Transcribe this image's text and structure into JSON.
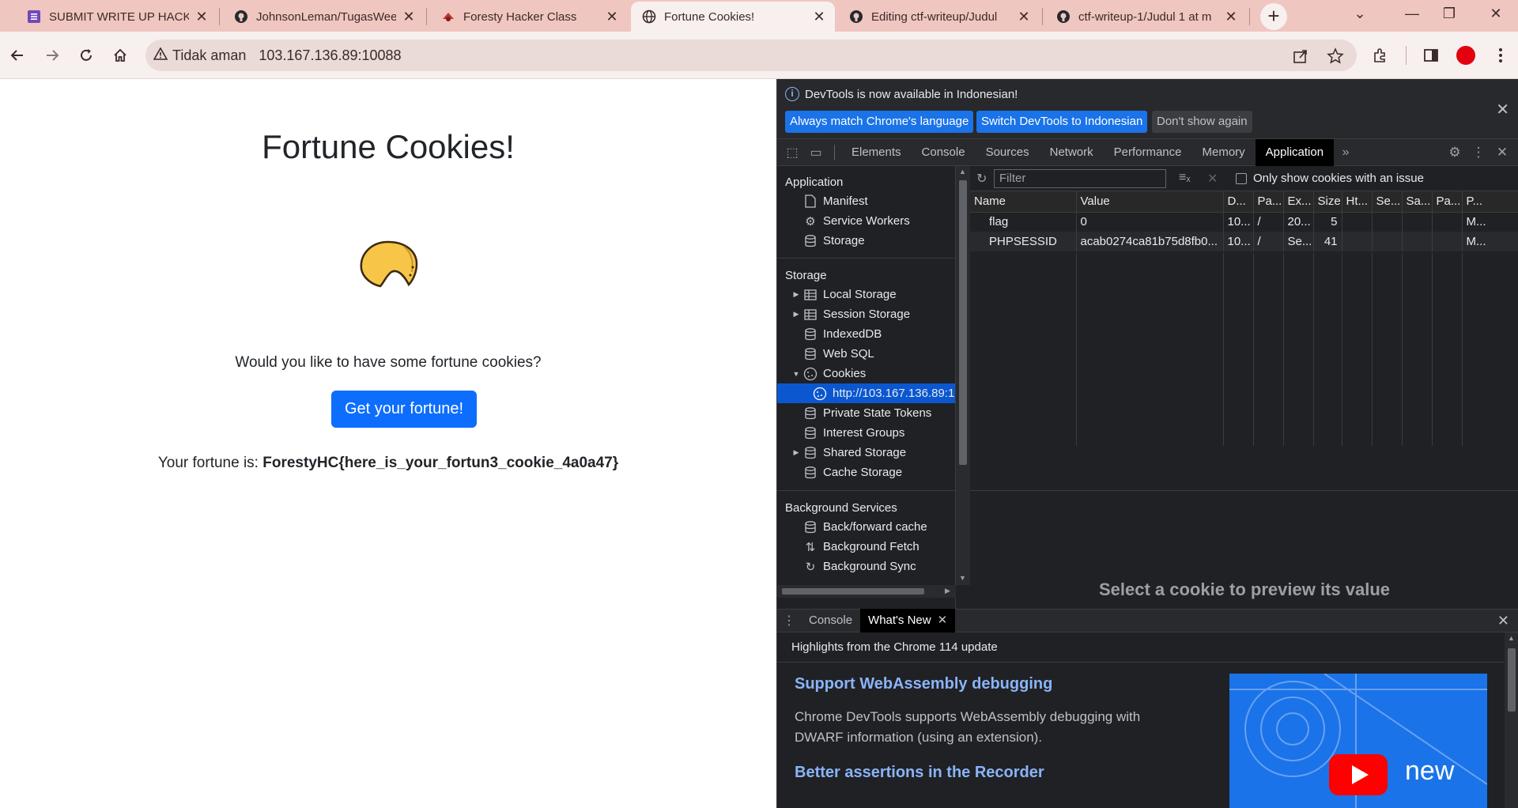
{
  "browser": {
    "tabs": [
      {
        "title": "SUBMIT WRITE UP HACKER",
        "icon": "forms-icon",
        "active": false
      },
      {
        "title": "JohnsonLeman/TugasWeek",
        "icon": "github-icon",
        "active": false
      },
      {
        "title": "Foresty Hacker Class",
        "icon": "ctfd-icon",
        "active": false
      },
      {
        "title": "Fortune Cookies!",
        "icon": "globe-icon",
        "active": true
      },
      {
        "title": "Editing ctf-writeup/Judul",
        "icon": "github-icon",
        "active": false
      },
      {
        "title": "ctf-writeup-1/Judul 1 at m",
        "icon": "github-icon",
        "active": false
      }
    ],
    "security_label": "Tidak aman",
    "url": "103.167.136.89:10088"
  },
  "page": {
    "title": "Fortune Cookies!",
    "question": "Would you like to have some fortune cookies?",
    "button_label": "Get your fortune!",
    "fortune_prefix": "Your fortune is: ",
    "fortune_value": "ForestyHC{here_is_your_fortun3_cookie_4a0a47}"
  },
  "devtools": {
    "infobar": {
      "message": "DevTools is now available in Indonesian!",
      "btn_match": "Always match Chrome's language",
      "btn_switch": "Switch DevTools to Indonesian",
      "btn_dismiss": "Don't show again"
    },
    "tabs": [
      "Elements",
      "Console",
      "Sources",
      "Network",
      "Performance",
      "Memory",
      "Application"
    ],
    "active_tab": "Application",
    "sidebar": {
      "application_header": "Application",
      "application_items": [
        "Manifest",
        "Service Workers",
        "Storage"
      ],
      "storage_header": "Storage",
      "storage_items": [
        "Local Storage",
        "Session Storage",
        "IndexedDB",
        "Web SQL",
        "Cookies",
        "http://103.167.136.89:1",
        "Private State Tokens",
        "Interest Groups",
        "Shared Storage",
        "Cache Storage"
      ],
      "background_header": "Background Services",
      "background_items": [
        "Back/forward cache",
        "Background Fetch",
        "Background Sync"
      ]
    },
    "cookies": {
      "filter_placeholder": "Filter",
      "only_issues_label": "Only show cookies with an issue",
      "columns": [
        "Name",
        "Value",
        "D...",
        "Pa...",
        "Ex...",
        "Size",
        "Ht...",
        "Se...",
        "Sa...",
        "Pa...",
        "P..."
      ],
      "rows": [
        [
          "flag",
          "0",
          "10...",
          "/",
          "20...",
          "5",
          "",
          "",
          "",
          "",
          "M..."
        ],
        [
          "PHPSESSID",
          "acab0274ca81b75d8fb0...",
          "10...",
          "/",
          "Se...",
          "41",
          "",
          "",
          "",
          "",
          "M..."
        ]
      ],
      "preview_message": "Select a cookie to preview its value"
    },
    "drawer": {
      "tabs": [
        "Console",
        "What's New"
      ],
      "active_tab": "What's New",
      "highlights": "Highlights from the Chrome 114 update",
      "heading1": "Support WebAssembly debugging",
      "paragraph1": "Chrome DevTools supports WebAssembly debugging with DWARF information (using an extension).",
      "heading2": "Better assertions in the Recorder",
      "thumb_badge": "new"
    }
  },
  "colors": {
    "tabstrip": "#f0c6c0",
    "toolbar": "#f7f0ef",
    "primary_button": "#0d6efd",
    "devtools_bg": "#202124",
    "devtools_selected": "#0b57d0",
    "link_blue": "#8ab4f8"
  }
}
